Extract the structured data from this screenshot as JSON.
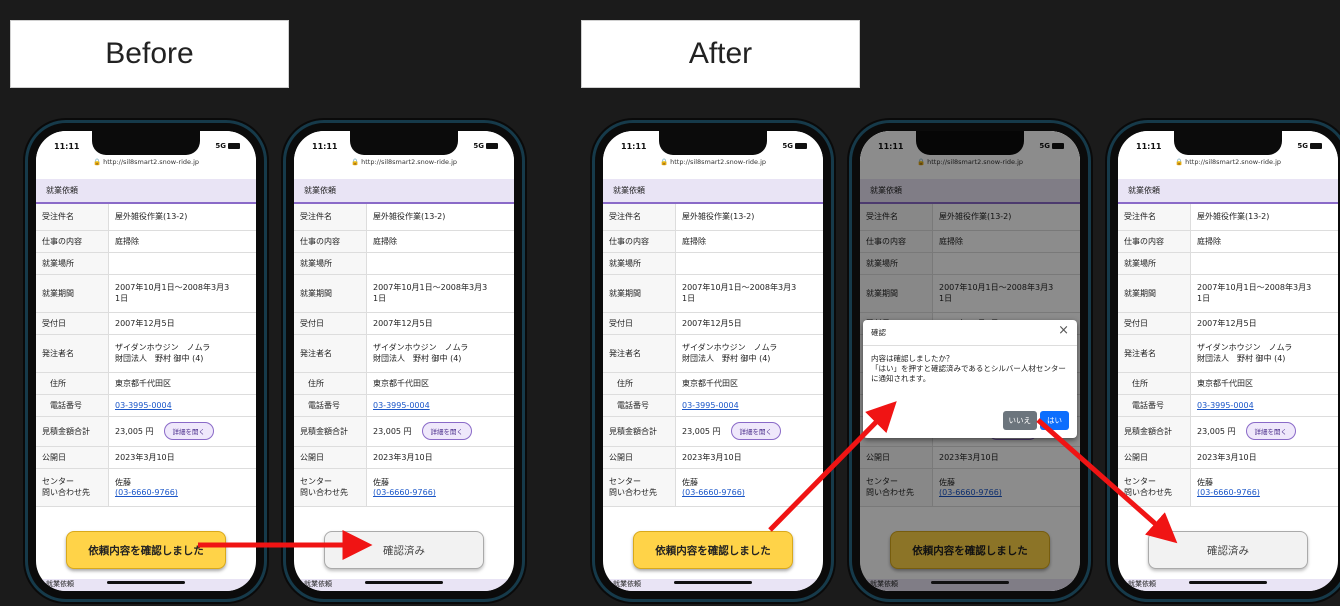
{
  "captions": {
    "before": "Before",
    "after": "After"
  },
  "phone": {
    "time": "11:11",
    "signal": "5G",
    "url": "http://sil8smart2.snow-ride.jp",
    "section_title": "就業依頼",
    "rows": [
      {
        "label": "受注件名",
        "value": "屋外雑役作業(13-2)"
      },
      {
        "label": "仕事の内容",
        "value": "庭掃除"
      },
      {
        "label": "就業場所",
        "value": ""
      },
      {
        "label": "就業期間",
        "value": "2007年10月1日～2008年3月3\n1日"
      },
      {
        "label": "受付日",
        "value": "2007年12月5日"
      },
      {
        "label": "発注者名",
        "value": "ザイダンホウジン　ノムラ\n財団法人　野村 御中 (4)"
      },
      {
        "label": "住所",
        "value": "東京都千代田区"
      },
      {
        "label": "電話番号",
        "value": "03-3995-0004"
      },
      {
        "label": "見積金額合計",
        "value": "23,005 円"
      },
      {
        "label": "公開日",
        "value": "2023年3月10日"
      },
      {
        "label": "センター\n問い合わせ先",
        "value": "佐藤"
      }
    ],
    "contact_phone": "(03-6660-9766)",
    "detail_button": "詳細を開く",
    "confirm_button": "依頼内容を確認しました",
    "confirmed_button": "確認済み",
    "next_section": "就業依頼"
  },
  "dialog": {
    "title": "確認",
    "body": "内容は確認しましたか？\n「はい」を押すと確認済みであるとシルバー人材センターに通知されます。",
    "no": "いいえ",
    "yes": "はい"
  },
  "colors": {
    "accent": "#8a6ac8",
    "section_bg": "#e9e4f5",
    "confirm_yellow": "#ffd348",
    "yes_blue": "#0d6efd",
    "arrow": "#f01414"
  }
}
